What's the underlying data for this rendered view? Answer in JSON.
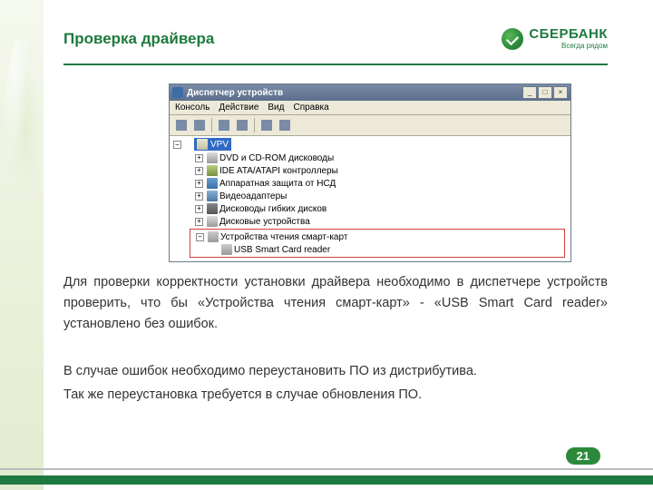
{
  "header": {
    "title": "Проверка драйвера",
    "logo_name": "СБЕРБАНК",
    "logo_tagline": "Всегда рядом"
  },
  "devmgr": {
    "title": "Диспетчер устройств",
    "menu": {
      "console": "Консоль",
      "action": "Действие",
      "view": "Вид",
      "help": "Справка"
    },
    "root": "VPV",
    "nodes": {
      "dvd": "DVD и CD-ROM дисководы",
      "ide": "IDE ATA/ATAPI контроллеры",
      "hw_protect": "Аппаратная защита от НСД",
      "video": "Видеоадаптеры",
      "floppy": "Дисководы гибких дисков",
      "disk": "Дисковые устройства",
      "smart_group": "Устройства чтения смарт-карт",
      "smart_item": "USB Smart Card reader"
    }
  },
  "body": {
    "p1": "Для проверки корректности установки драйвера необходимо в диспетчере устройств проверить, что бы «Устройства чтения смарт-карт» - «USB Smart Card reader» установлено без ошибок.",
    "p2": "В случае ошибок необходимо переустановить ПО из дистрибутива.",
    "p3": "Так же переустановка требуется в случае обновления ПО."
  },
  "page_number": "21"
}
